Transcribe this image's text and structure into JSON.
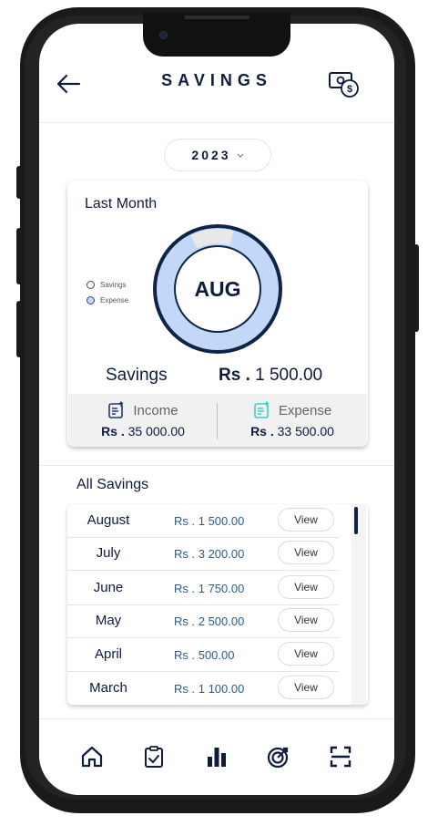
{
  "header": {
    "title": "SAVINGS",
    "back_icon": "arrow-left-icon",
    "action_icon": "money-dollar-icon"
  },
  "year_selector": {
    "value": "2023",
    "icon": "chevron-down-icon"
  },
  "last_month": {
    "title": "Last Month",
    "month": "AUG",
    "legend": [
      {
        "label": "Savings",
        "color": "#ffffff"
      },
      {
        "label": "Expense",
        "color": "#c3d8f8"
      }
    ],
    "donut": {
      "savings_fraction": 0.043,
      "expense_fraction": 0.957
    },
    "savings_label": "Savings",
    "savings_prefix": "Rs .",
    "savings_amount": "1 500.00",
    "income": {
      "label": "Income",
      "prefix": "Rs .",
      "amount": "35 000.00"
    },
    "expense": {
      "label": "Expense",
      "prefix": "Rs .",
      "amount": "33 500.00"
    }
  },
  "all_savings": {
    "title": "All Savings",
    "rows": [
      {
        "month": "August",
        "amount": "Rs . 1 500.00",
        "action": "View"
      },
      {
        "month": "July",
        "amount": "Rs . 3 200.00",
        "action": "View"
      },
      {
        "month": "June",
        "amount": "Rs . 1 750.00",
        "action": "View"
      },
      {
        "month": "May",
        "amount": "Rs . 2 500.00",
        "action": "View"
      },
      {
        "month": "April",
        "amount": "Rs . 500.00",
        "action": "View"
      },
      {
        "month": "March",
        "amount": "Rs . 1 100.00",
        "action": "View"
      }
    ]
  },
  "nav": [
    "home-icon",
    "clipboard-check-icon",
    "bar-chart-icon",
    "target-icon",
    "scan-icon"
  ],
  "colors": {
    "primary": "#0f1b3d",
    "ring": "#c3d8f8",
    "amount": "#2e5c86"
  }
}
